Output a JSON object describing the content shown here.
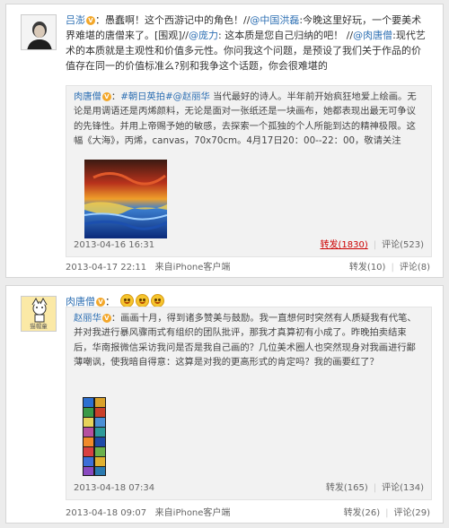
{
  "post1": {
    "author": "吕澎",
    "text_parts": [
      "：愚蠢啊！这个西游记中的角色！//",
      "@中国洪磊",
      ":今晚这里好玩，一个要美术界难堪的唐僧来了。[围观]//",
      "@庞力",
      ": 这本质是您自己归纳的吧！ //",
      "@肉唐僧",
      ":现代艺术的本质就是主观性和价值多元性。你问我这个问题，是预设了我们关于作品的价值存在同一的价值标准么?别和我争这个话题，你会很难堪的"
    ],
    "repost": {
      "author": "肉唐僧",
      "text_parts": [
        "：",
        "#朝日英拍#",
        "@赵丽华",
        " 当代最好的诗人。半年前开始疯狂地爱上绘画。无论是用调语还是丙烯颜料，无论是面对一张纸还是一块画布，她都表现出最无可争议的先锋性。并用上帝赐予她的敏感，去探索一个孤独的个人所能到达的精神极限。这幅《大海》，丙烯，canvas，70x70cm。4月17日20：00--22：00，敬请关注"
      ],
      "time": "2013-04-16 16:31",
      "repost_label": "转发(1830)",
      "comment_label": "评论(523)"
    },
    "time": "2013-04-17 22:11",
    "source": "来自iPhone客户端",
    "repost_label": "转发(10)",
    "comment_label": "评论(8)"
  },
  "post2": {
    "author": "肉唐僧",
    "avatar_caption": "猫帽童",
    "repost": {
      "author": "赵丽华",
      "text": "：画画十月，得到诸多赞美与鼓励。我一直想何时突然有人质疑我有代笔、并对我进行暴风骤雨式有组织的团队批评，那我才真算初有小成了。昨晚拍卖结束后，华南报微信采访我问是否是我自己画的？几位美术圈人也突然现身对我画进行鄙薄嘲讽，使我暗自得意：这算是对我的更高形式的肯定吗？我的画要红了？",
      "time": "2013-04-18 07:34",
      "repost_label": "转发(165)",
      "comment_label": "评论(134)"
    },
    "time": "2013-04-18 09:07",
    "source": "来自iPhone客户端",
    "repost_label": "转发(26)",
    "comment_label": "评论(29)"
  },
  "colors": {
    "link": "#2d6fb3",
    "badge": "#f3a72a",
    "alert": "#cc0000"
  }
}
